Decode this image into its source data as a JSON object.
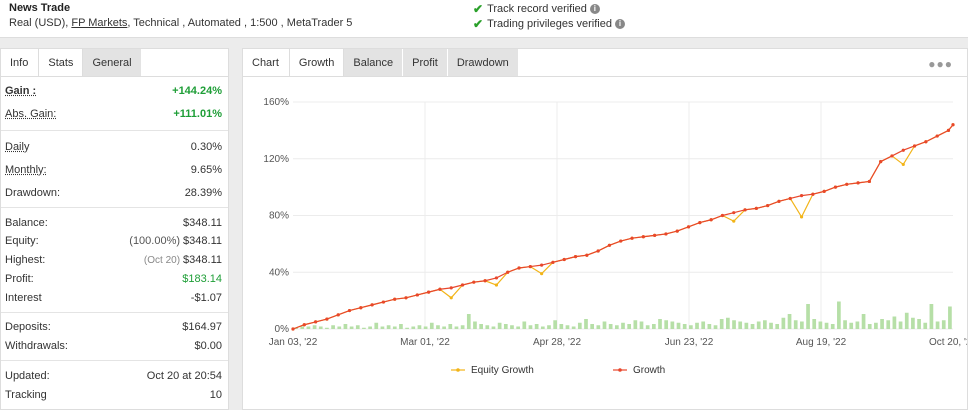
{
  "header": {
    "name": "News Trade",
    "meta_prefix": "Real (USD),",
    "broker": "FP Markets",
    "meta_suffix": ", Technical , Automated , 1:500 , MetaTrader 5",
    "verify1": "Track record verified",
    "verify2": "Trading privileges verified"
  },
  "left_tabs": [
    "Info",
    "Stats",
    "General"
  ],
  "stats": {
    "gain": {
      "label": "Gain :",
      "value": "+144.24%"
    },
    "abs_gain": {
      "label": "Abs. Gain:",
      "value": "+111.01%"
    },
    "daily": {
      "label": "Daily",
      "value": "0.30%"
    },
    "monthly": {
      "label": "Monthly:",
      "value": "9.65%"
    },
    "drawdown": {
      "label": "Drawdown:",
      "value": "28.39%"
    },
    "balance": {
      "label": "Balance:",
      "value": "$348.11"
    },
    "equity": {
      "label": "Equity:",
      "prefix": "(100.00%)",
      "value": "$348.11"
    },
    "highest": {
      "label": "Highest:",
      "prefix": "(Oct 20)",
      "value": "$348.11"
    },
    "profit": {
      "label": "Profit:",
      "value": "$183.14"
    },
    "interest": {
      "label": "Interest",
      "value": "-$1.07"
    },
    "deposits": {
      "label": "Deposits:",
      "value": "$164.97"
    },
    "withdrawals": {
      "label": "Withdrawals:",
      "value": "$0.00"
    },
    "updated": {
      "label": "Updated:",
      "value": "Oct 20 at 20:54"
    },
    "tracking": {
      "label": "Tracking",
      "value": "10"
    }
  },
  "right_tabs": [
    "Chart",
    "Growth",
    "Balance",
    "Profit",
    "Drawdown"
  ],
  "more_icon": "more-dots-icon",
  "colors": {
    "growth": "#e8472c",
    "equity": "#f2b418",
    "bars": "#b6dfa7",
    "green": "#1e9e37"
  },
  "chart_data": {
    "type": "line",
    "x_ticks": [
      "Jan 03, '22",
      "Mar 01, '22",
      "Apr 28, '22",
      "Jun 23, '22",
      "Aug 19, '22",
      "Oct 20, '22"
    ],
    "y_ticks": [
      "0%",
      "40%",
      "80%",
      "120%",
      "160%"
    ],
    "ylim": [
      0,
      160
    ],
    "grid": true,
    "legend_position": "bottom",
    "x": [
      0,
      5,
      10,
      15,
      20,
      25,
      30,
      35,
      40,
      45,
      50,
      55,
      60,
      65,
      70,
      75,
      80,
      85,
      90,
      95,
      100,
      105,
      110,
      115,
      120,
      125,
      130,
      135,
      140,
      145,
      150,
      155,
      160,
      165,
      170,
      175,
      180,
      185,
      190,
      195,
      200,
      205,
      210,
      215,
      220,
      225,
      230,
      235,
      240,
      245,
      250,
      255,
      260,
      265,
      270,
      275,
      280,
      285,
      290,
      292
    ],
    "series": [
      {
        "name": "Growth",
        "values": [
          0,
          3,
          5,
          7,
          10,
          13,
          15,
          17,
          19,
          21,
          22,
          24,
          26,
          28,
          29,
          31,
          33,
          34,
          36,
          40,
          43,
          44,
          45,
          47,
          49,
          51,
          52,
          55,
          59,
          62,
          64,
          65,
          66,
          67,
          69,
          72,
          75,
          77,
          80,
          82,
          84,
          85,
          87,
          90,
          92,
          94,
          95,
          97,
          100,
          102,
          103,
          104,
          118,
          122,
          126,
          129,
          132,
          136,
          140,
          144
        ]
      },
      {
        "name": "Equity Growth",
        "values": [
          0,
          3,
          5,
          7,
          10,
          13,
          15,
          17,
          19,
          21,
          22,
          24,
          26,
          28,
          22,
          31,
          33,
          34,
          31,
          40,
          43,
          44,
          39,
          47,
          49,
          51,
          52,
          55,
          59,
          62,
          64,
          65,
          66,
          67,
          69,
          72,
          75,
          77,
          80,
          76,
          84,
          85,
          87,
          90,
          92,
          79,
          95,
          97,
          100,
          102,
          103,
          104,
          118,
          122,
          116,
          129,
          132,
          136,
          140,
          144
        ]
      }
    ],
    "daily_bars": [
      1,
      2,
      2,
      3,
      2,
      1,
      3,
      2,
      4,
      2,
      3,
      1,
      2,
      5,
      2,
      3,
      2,
      4,
      1,
      2,
      3,
      2,
      5,
      3,
      2,
      4,
      2,
      3,
      12,
      6,
      4,
      3,
      2,
      5,
      4,
      3,
      2,
      6,
      3,
      4,
      2,
      3,
      7,
      4,
      3,
      2,
      5,
      8,
      4,
      3,
      6,
      4,
      3,
      5,
      4,
      7,
      6,
      3,
      4,
      8,
      7,
      6,
      5,
      4,
      3,
      5,
      6,
      4,
      3,
      8,
      9,
      7,
      6,
      5,
      4,
      6,
      7,
      5,
      4,
      9,
      12,
      7,
      6,
      20,
      8,
      6,
      5,
      4,
      22,
      7,
      5,
      6,
      12,
      4,
      5,
      8,
      7,
      10,
      6,
      13,
      9,
      8,
      5,
      20,
      6,
      7,
      18
    ]
  }
}
